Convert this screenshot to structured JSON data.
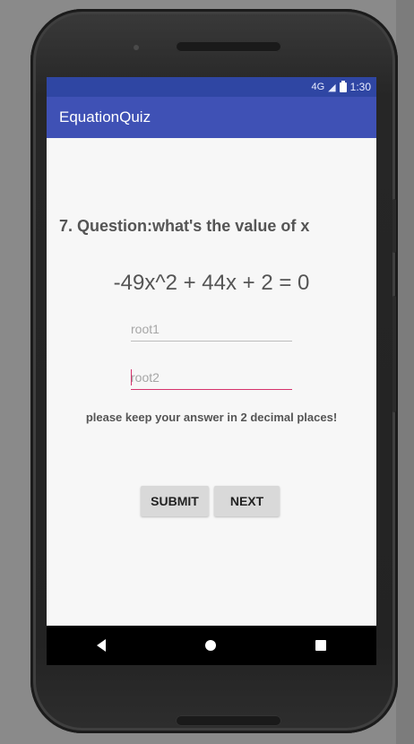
{
  "status_bar": {
    "network": "4G",
    "time": "1:30"
  },
  "app_bar": {
    "title": "EquationQuiz"
  },
  "quiz": {
    "question": "7. Question:what's the value of x",
    "equation": "-49x^2 + 44x + 2 = 0",
    "root1_placeholder": "root1",
    "root2_placeholder": "root2",
    "hint": "please keep your answer in 2 decimal places!",
    "submit_label": "SUBMIT",
    "next_label": "NEXT"
  },
  "colors": {
    "status_bar": "#2f46a3",
    "app_bar": "#3f51b5",
    "accent": "#d6336c"
  },
  "icons": {
    "nav_back": "back-triangle-icon",
    "nav_home": "home-circle-icon",
    "nav_recent": "recent-square-icon"
  }
}
